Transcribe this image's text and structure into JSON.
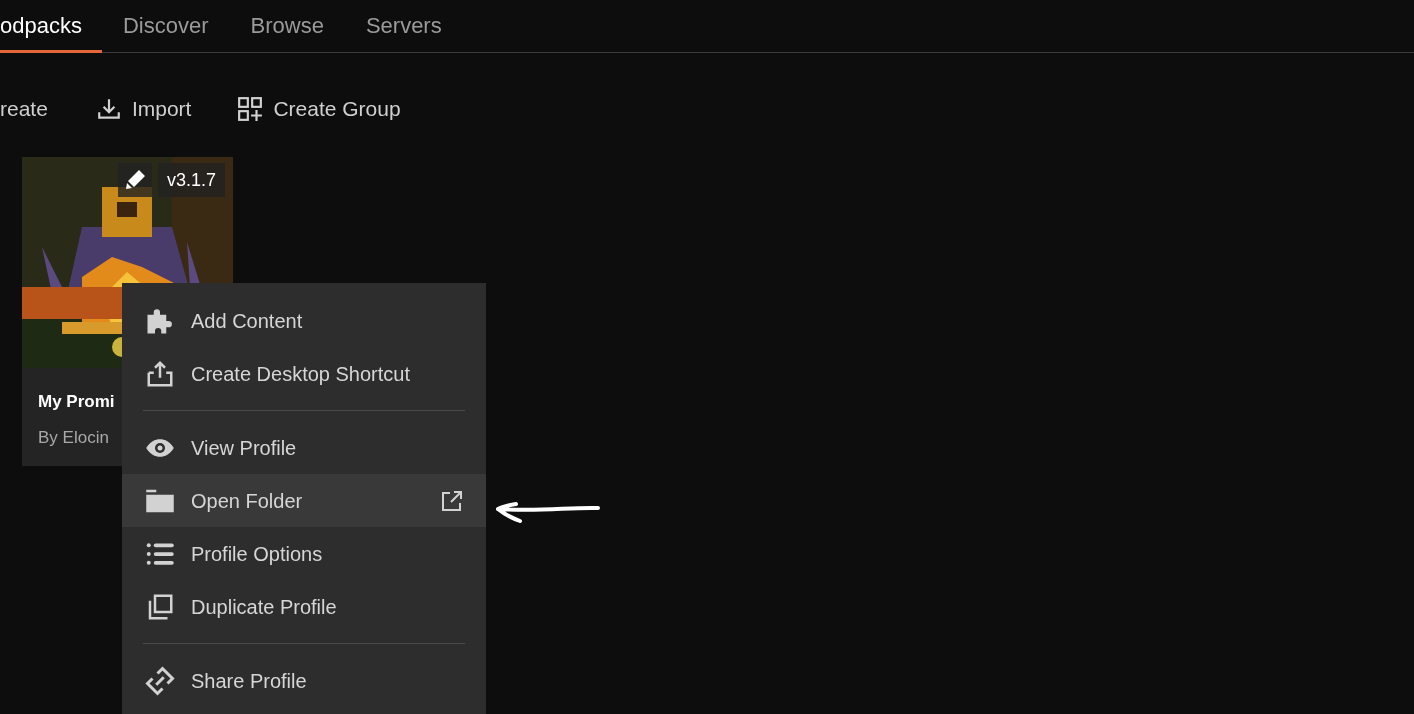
{
  "tabs": [
    {
      "label": "odpacks",
      "selected": true
    },
    {
      "label": "Discover",
      "selected": false
    },
    {
      "label": "Browse",
      "selected": false
    },
    {
      "label": "Servers",
      "selected": false
    }
  ],
  "toolbar": [
    {
      "label": "reate"
    },
    {
      "label": "Import"
    },
    {
      "label": "Create Group"
    }
  ],
  "card": {
    "kind": "picture",
    "version": "v3.1.7",
    "title": "My Promi",
    "author": "By Elocin"
  },
  "menu": [
    {
      "kind": "item",
      "label": "Add Content",
      "highlighted": false,
      "external": false
    },
    {
      "kind": "item",
      "label": "Create Desktop Shortcut",
      "highlighted": false,
      "external": false
    },
    {
      "kind": "divider"
    },
    {
      "kind": "item",
      "label": "View Profile",
      "highlighted": false,
      "external": false
    },
    {
      "kind": "item",
      "label": "Open Folder",
      "highlighted": true,
      "external": true
    },
    {
      "kind": "item",
      "label": "Profile Options",
      "highlighted": false,
      "external": false
    },
    {
      "kind": "item",
      "label": "Duplicate Profile",
      "highlighted": false,
      "external": false
    },
    {
      "kind": "divider"
    },
    {
      "kind": "item",
      "label": "Share Profile",
      "highlighted": false,
      "external": false
    }
  ]
}
